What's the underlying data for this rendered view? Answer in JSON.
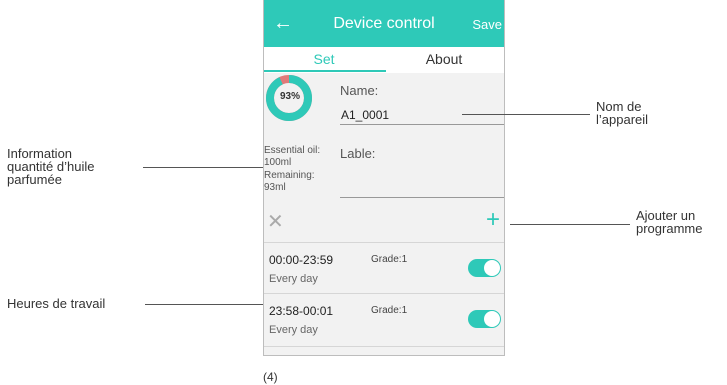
{
  "app": {
    "title": "Device control",
    "save_label": "Save"
  },
  "tabs": [
    {
      "label": "Set",
      "active": true
    },
    {
      "label": "About",
      "active": false
    }
  ],
  "oil_gauge": {
    "percent_label": "93%",
    "fraction": 0.93,
    "fill_color": "#2ec9b8",
    "remaining_color": "#e07a7a"
  },
  "name_field": {
    "label": "Name:",
    "value": "A1_0001"
  },
  "oil_info": {
    "essential_label": "Essential oil:",
    "essential_value": "100ml",
    "remaining_label": "Remaining:",
    "remaining_value": "93ml"
  },
  "lable_field": {
    "label": "Lable:",
    "value": ""
  },
  "actions": {
    "delete_icon": "close-icon",
    "add_icon": "plus-icon"
  },
  "schedules": [
    {
      "time": "00:00-23:59",
      "day": "Every day",
      "grade": "Grade:1",
      "enabled": true
    },
    {
      "time": "23:58-00:01",
      "day": "Every day",
      "grade": "Grade:1",
      "enabled": true
    }
  ],
  "annotations": {
    "info_line1": "Information",
    "info_line2": "quantité d’huile",
    "info_line3": "parfumée",
    "hours": "Heures de travail",
    "name_line1": "Nom de",
    "name_line2": "l’appareil",
    "prog_line1": "Ajouter un",
    "prog_line2": "programme"
  },
  "caption": "(4)",
  "colors": {
    "accent": "#2ec9b8"
  }
}
